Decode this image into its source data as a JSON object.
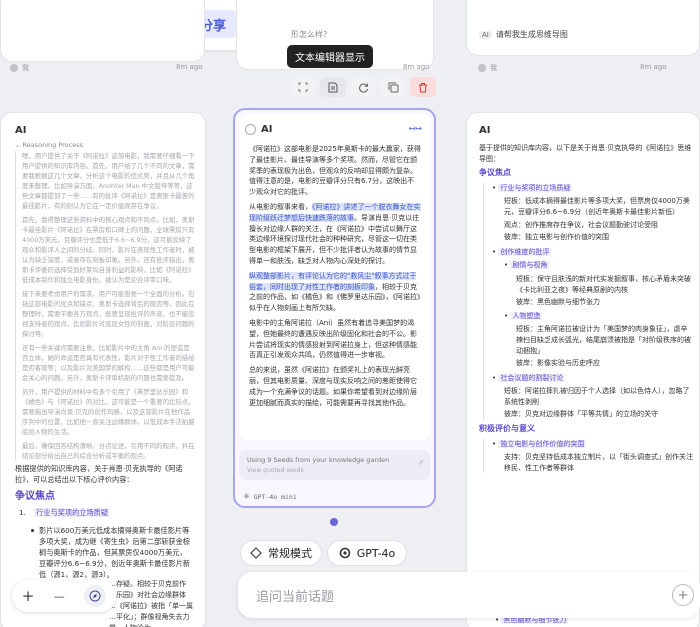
{
  "toolbar": {
    "share_label": "分享",
    "avatar_letter": "t",
    "tooltip": "文本编辑器显示"
  },
  "top_cards": {
    "left_age": "8m ago",
    "mid_placeholder": "形怎么样?",
    "mid_age": "8m ago",
    "right_badge": "AI",
    "right_title": "请帮我生成思维导图",
    "right_age": "8m ago",
    "left_user": "我",
    "right_user": "我"
  },
  "left_card": {
    "header": "AI",
    "reasoning_label": "Reasoning Process",
    "reasoning_paragraphs": [
      "嗯，用户提供了关于《阿诺拉》这部电影，我需要仔细看一下用户提供的知识库内容。首先，用户给了几个不同的文章，需要我根据这几个文章，分析这个电影的优劣势，并且从几个角度来整理。比如导演方面，Anohter Man 中文版导等等，这些文章都提到了一些……有的批评《阿诺拉》是奥斯卡最差的最佳影片，有的则认为它在一定价值观存在争议。",
      "首先，我得整理这些资料中的核心观点和不同点。比如，奥斯卡最佳影片《阿诺拉》在票房和口碑上的问题，全球票房只有4000万美元，豆瓣评分也是低于6.6~6.9分，这可能反映了观众和影评人之间的分歧。同时，影片在表现性工作者时，被认为缺乏深度，或者存在刻板印象。另外，还有批评指出，奥斯卡评委的选择受到好莱坞自身利益的影响，比如《阿诺拉》低成本制作和独立电影身份，被认为是迎合评审口味。",
      "接下来要考虑用户的需求。用户可能想要一个全面的分析，包括这部电影的优点和缺点、奥斯卡选择背后的原因等。因此在整理时，需要平衡各方观点，既要呈现批评的声音，也不能忽视支持者的观点，比如影片对底层女性的刻画，对阶层问题的探讨等。",
      "还有一些关键点需要注意，比如影片中的主角 Ani 的塑造是否立体，她的命运是否具有代表性，影片对于性工作者的描绘是否客观等；以及影片对美国梦的解构……这些都是用户可能会关心的问题。另外，奥斯卡评审机制的问题也需要提及。",
      "另外，用户提供的材料中有多个引用了《弗罗里达乐园》和《橘色》与《阿诺拉》的对比，这可能是一个重要的比较点。需要指出导演肖恩·贝克的创作风格，以及这部影片在他作品序列中的位置，比如他一直关注边缘群体，以低成本手法拍摄底层人物的生活。",
      "最后，确保回答结构清晰，分点论述，引用不同的观点，并在结论部分给出自己的综合分析或平衡的观点。"
    ],
    "summary": "根据提供的知识库内容，关于肖恩·贝克执导的《阿诺拉》，可以总结出以下核心评价内容：",
    "section_title": "争议焦点",
    "item1_num": "1.",
    "item1_title": "行业与奖项的立场质疑",
    "bullet_text": "影片以600万美元低成本摘得奥斯卡最佳影片等多项大奖，成为继《寄生虫》后第二部斩获金棕榈与奥斯卡的作品，但其票房仅4000万美元，豆瓣评分6.6~6.9分，创近年奥斯卡最佳影片新低（源1，源2，源3）。",
    "bottom_lines": [
      "…存疑。相较于贝克前作",
      "…乐园》对社会边缘群体",
      "…《阿诺拉》被指「单一属",
      "…平化」；群像视角失去力量，人物沦为"
    ]
  },
  "mid_card": {
    "header": "AI",
    "p1": "《阿诺拉》这部电影是2025年奥斯卡的最大赢家，获得了最佳影片、最佳导演等多个奖项。然而，尽管它在颁奖季的表现极为出色，但观众的反响却显得颇为复杂。值得注意的是，电影的豆瓣评分只有6.7分，这映出不少观众对它的批评。",
    "p2_pre": "从电影的叙事来看，",
    "p2_hl1": "《阿诺拉》讲述了一个脱衣舞女在实现阶级跃迁梦想后快速跌落的故事",
    "p2_rest": "。导演肖恩·贝克以往擅长对边缘人群的关注，在《阿诺拉》中尝试以舞厅这类边缘环境探讨现代社会的种种研究，尽管这一切在类型电影的框架下展开，但不少批评者认为故事的情节显得单一和肤浅，缺乏对人物内心深处的探讨。",
    "p3_hl": "纵观整部影片，有评论认为它的\"救风尘\"叙事方式过于俗套，同时出现了对性工作者的刻板印象",
    "p3_rest": "，相较于贝克之前的作品，如《橘色》和《佛罗里达乐园》，《阿诺拉》似乎在人物刻画上有所欠缺。",
    "p4": "电影中的主角阿诺拉（Ani）虽然有着追寻美国梦的渴望，但她最终的遭遇反映出阶级固化和社会的不公。影片尝试将现实的情感投射到阿诺拉身上，但这种情感能否真正引发观众共鸣，仍然值得进一步审视。",
    "p5": "总的来说，虽然《阿诺拉》在颁奖礼上的表现光鲜亮丽，但其电影质量、深度与现实反响之间的差距使得它成为一个充满争议的话题。如果你希望看到对边缘阶层更加细腻而真实的描绘，可能需要再寻找其他作品。",
    "seeds_text": "Using 9 Seeds from your knowledge garden",
    "seeds_sub": "View quoted seeds",
    "model_label": "GPT-4o mini"
  },
  "right_card": {
    "header": "AI",
    "intro": "基于提供的知识库内容，以下是关于肖恩·贝克执导的《阿诺拉》思维导图：",
    "h_focus": "争议焦点",
    "n1": "行业与奖项的立场质疑",
    "b1": "短板：低成本摘得最佳影片等多项大奖，但票房仅4000万美元，豆瓣评分6.6~6.9分（创近年奥斯卡最佳影片新低）",
    "b2": "观点：创作推席存在争议，社会议题勤驶讨论受阻",
    "b3": "彼岸：独立电影与创作价值的突围",
    "n2": "创作维度的批评",
    "n2a": "剧情与视角",
    "b4": "短板：保守且肤浅的新对代实发掘叙事，核心矛盾未突破《卡比利亚之夜》等经典原剧的内核",
    "b5": "彼岸：黑色幽默与细节张力",
    "n2b": "人物塑造",
    "b6": "短板：主角阿诺拉被设计为「美国梦的肉身象征」，虐辛辣扫目缺乏成长弧光，结尾崩溃被指是「对阶级秩序的被动捆抱」",
    "b7": "彼岸：影像实验与历史呼应",
    "n3": "社会议题的割裂讨论",
    "b8": "短板：阿诺拉摔扎被归因于个人选择（如以色侍人），忽略了系统性剥削",
    "b9": "彼岸：贝克对边缘群体「平等共情」的立场的关守",
    "h_value": "积极评价与意义",
    "n4": "独立电影与创作价值的突围",
    "b10": "支持：贝克坚持低成本独立制片，以「街头调查式」创作关注移民、性工作者等群体",
    "last_item": "黑色幽默与细节张力"
  },
  "bottom": {
    "mode_label": "常规模式",
    "model_label": "GPT-4o",
    "input_placeholder": "追问当前话题",
    "zoom_plus": "+",
    "zoom_minus": "—"
  }
}
